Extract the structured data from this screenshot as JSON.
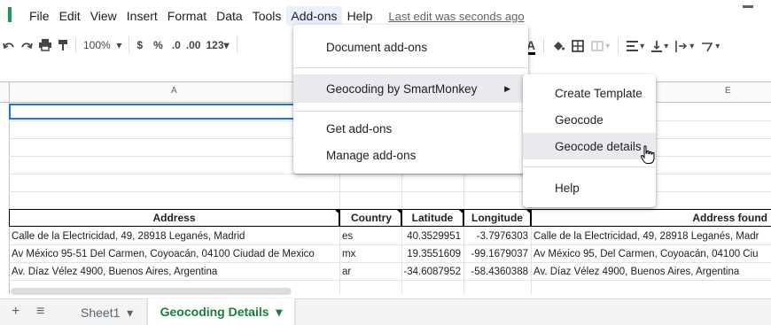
{
  "menubar": {
    "items": [
      "File",
      "Edit",
      "View",
      "Insert",
      "Format",
      "Data",
      "Tools",
      "Add-ons",
      "Help"
    ],
    "last_edit": "Last edit was seconds ago",
    "active_item": "Add-ons"
  },
  "toolbar": {
    "zoom": "100%",
    "currency": "$",
    "percent": "%",
    "decrease_decimal": ".0",
    "increase_decimal": ".00",
    "number_format": "123",
    "text_color_label": "A"
  },
  "columns": {
    "a": "A",
    "e": "E"
  },
  "table": {
    "headers": [
      "Address",
      "Country",
      "Latitude",
      "Longitude",
      "Address found"
    ],
    "rows": [
      [
        "Calle de la Electricidad, 49, 28918 Leganés, Madrid",
        "es",
        "40.3529951",
        "-3.7976303",
        "Calle de la Electricidad, 49, 28918 Leganés, Madr"
      ],
      [
        "Av México 95-51 Del Carmen, Coyoacán, 04100 Ciudad de Mexico",
        "mx",
        "19.3551609",
        "-99.1679037",
        "Av México 95, Del Carmen, Coyoacán, 04100 Ciu"
      ],
      [
        "Av. Díaz Vélez 4900, Buenos Aires, Argentina",
        "ar",
        "-34.6087952",
        "-58.4360388",
        "Av. Díaz Vélez 4900, Buenos Aires, Argentina"
      ]
    ]
  },
  "addons_menu": {
    "items": [
      "Document add-ons",
      "Geocoding by SmartMonkey",
      "Get add-ons",
      "Manage add-ons"
    ]
  },
  "submenu": {
    "items": [
      "Create Template",
      "Geocode",
      "Geocode details",
      "Help"
    ],
    "highlighted": "Geocode details"
  },
  "sheets": {
    "tabs": [
      "Sheet1",
      "Geocoding Details"
    ],
    "active": "Geocoding Details"
  },
  "colors": {
    "accent_green": "#188038",
    "selection_blue": "#1a73e8",
    "menu_active": "#e8f0fe"
  }
}
